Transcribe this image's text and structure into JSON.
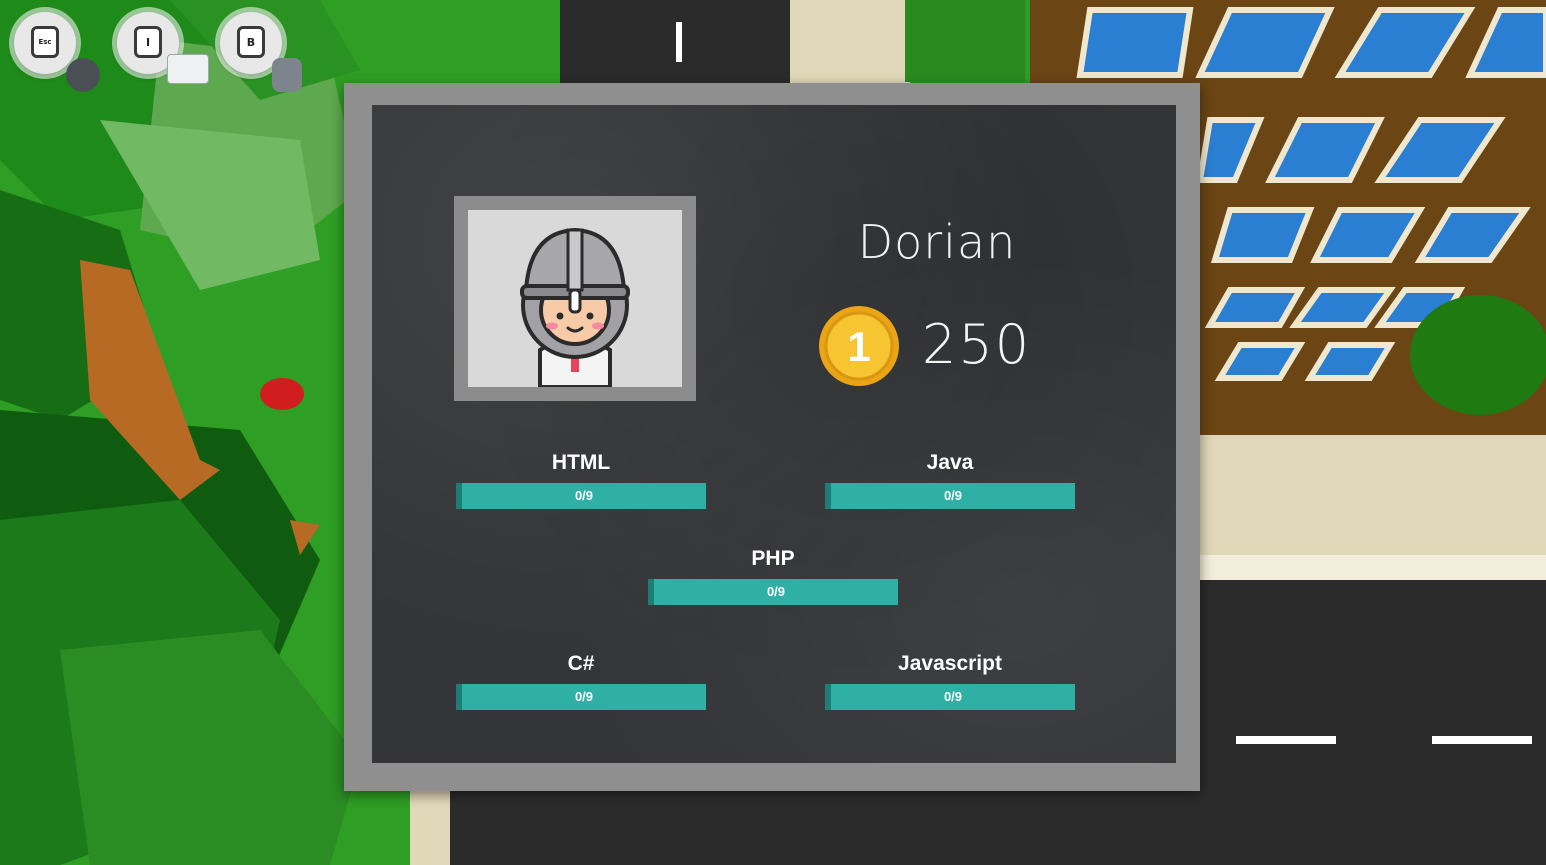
{
  "hud": {
    "hotkeys": [
      {
        "key": "Esc",
        "name": "settings"
      },
      {
        "key": "I",
        "name": "profile"
      },
      {
        "key": "B",
        "name": "backpack"
      }
    ]
  },
  "profile": {
    "player_name": "Dorian",
    "coins": "250",
    "coin_symbol": "1"
  },
  "skills": [
    {
      "name": "HTML",
      "progress": "0/9",
      "value": 0,
      "max": 9
    },
    {
      "name": "Java",
      "progress": "0/9",
      "value": 0,
      "max": 9
    },
    {
      "name": "PHP",
      "progress": "0/9",
      "value": 0,
      "max": 9
    },
    {
      "name": "C#",
      "progress": "0/9",
      "value": 0,
      "max": 9
    },
    {
      "name": "Javascript",
      "progress": "0/9",
      "value": 0,
      "max": 9
    }
  ],
  "colors": {
    "progress_bar": "#2eb0a5",
    "board": "#333538",
    "frame": "#8f8f8f",
    "coin": "#f2b51e"
  }
}
